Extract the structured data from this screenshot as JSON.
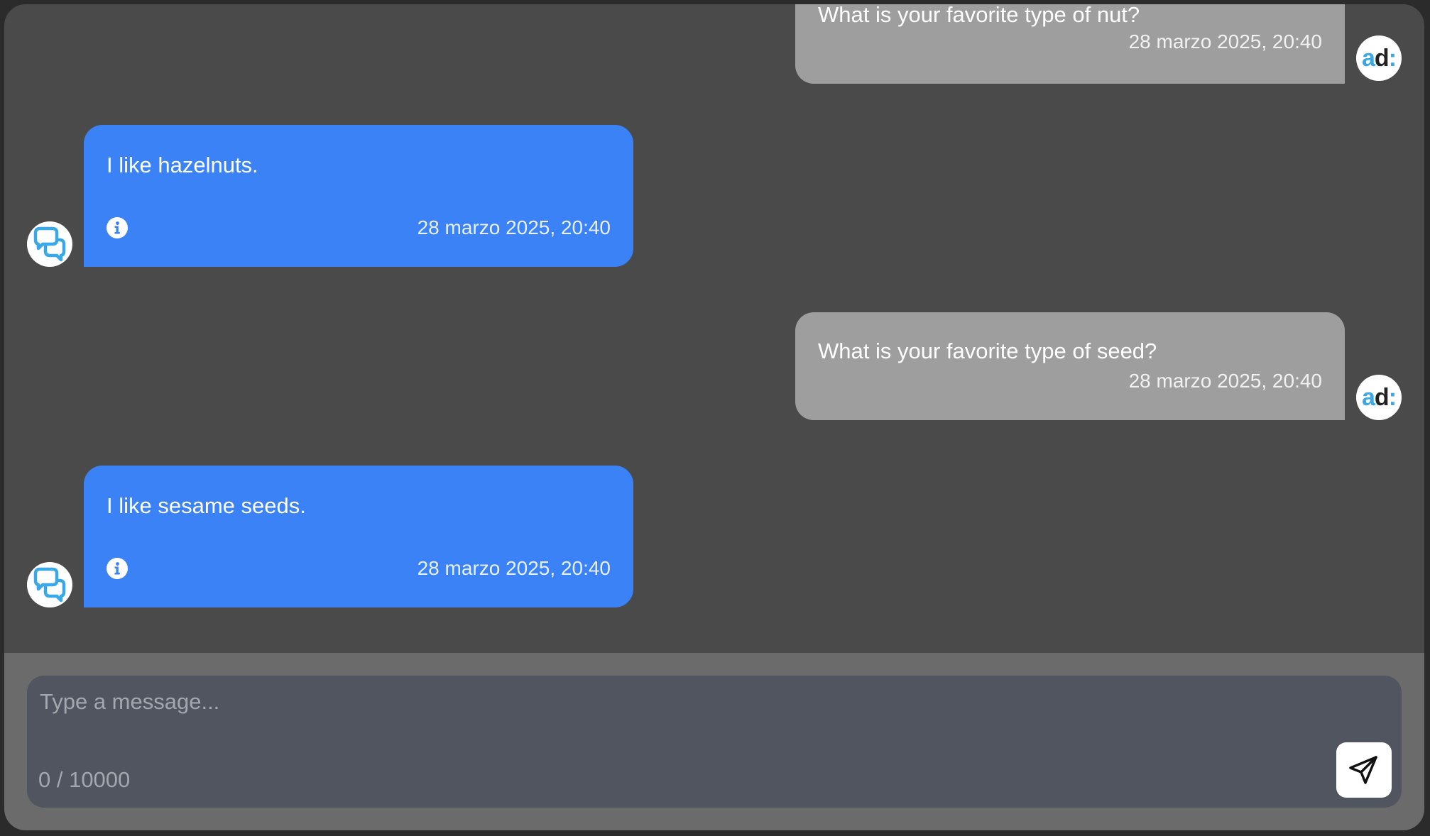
{
  "messages": [
    {
      "role": "user",
      "text": "What is your favorite type of nut?",
      "time": "28 marzo 2025, 20:40",
      "avatar": "ad-logo-avatar"
    },
    {
      "role": "assistant",
      "text": "I like hazelnuts.",
      "time": "28 marzo 2025, 20:40",
      "avatar": "chat-bubbles-logo-avatar"
    },
    {
      "role": "user",
      "text": "What is your favorite type of seed?",
      "time": "28 marzo 2025, 20:40",
      "avatar": "ad-logo-avatar"
    },
    {
      "role": "assistant",
      "text": "I like sesame seeds.",
      "time": "28 marzo 2025, 20:40",
      "avatar": "chat-bubbles-logo-avatar"
    }
  ],
  "user_avatar": {
    "a": "a",
    "d": "d",
    "colon": ":"
  },
  "composer": {
    "placeholder": "Type a message...",
    "char_count": "0 / 10000",
    "send_icon": "paper-plane-icon"
  },
  "colors": {
    "background": "#4a4a4a",
    "user_bubble": "#9e9e9e",
    "assistant_bubble": "#3b82f6",
    "composer_bar": "#6b6b6b",
    "input": "#505560",
    "logo_blue": "#3aa7e6"
  }
}
